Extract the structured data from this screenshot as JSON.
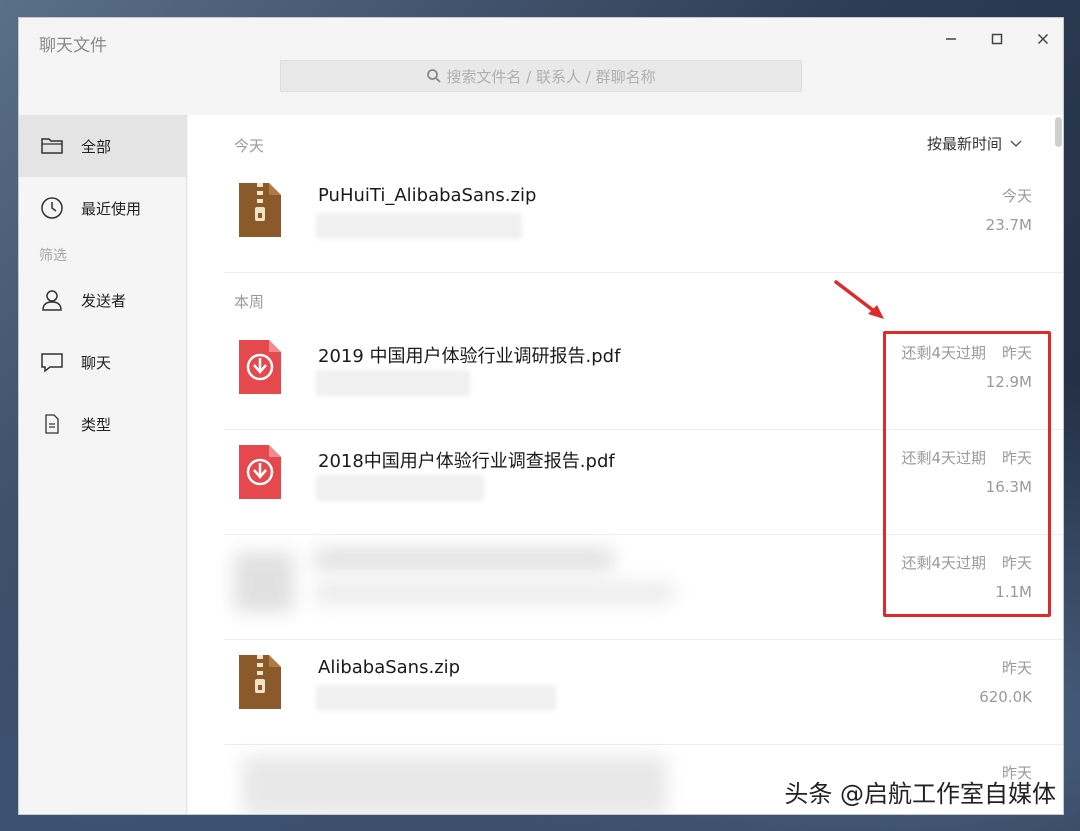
{
  "window": {
    "title": "聊天文件",
    "search_placeholder": "搜索文件名 / 联系人 / 群聊名称"
  },
  "sidebar": {
    "items": [
      {
        "label": "全部",
        "icon": "folder-icon",
        "active": true
      },
      {
        "label": "最近使用",
        "icon": "clock-icon"
      }
    ],
    "filter_label": "筛选",
    "filters": [
      {
        "label": "发送者",
        "icon": "person-icon"
      },
      {
        "label": "聊天",
        "icon": "chat-bubble-icon"
      },
      {
        "label": "类型",
        "icon": "document-icon"
      }
    ]
  },
  "main": {
    "sort_label": "按最新时间",
    "groups": [
      {
        "label": "今天"
      },
      {
        "label": "本周"
      }
    ],
    "files": [
      {
        "name": "PuHuiTi_AlibabaSans.zip",
        "type": "zip",
        "expiry": "",
        "time": "今天",
        "size": "23.7M"
      },
      {
        "name": "2019 中国用户体验行业调研报告.pdf",
        "type": "pdf",
        "expiry": "还剩4天过期",
        "time": "昨天",
        "size": "12.9M"
      },
      {
        "name": "2018中国用户体验行业调查报告.pdf",
        "type": "pdf",
        "expiry": "还剩4天过期",
        "time": "昨天",
        "size": "16.3M"
      },
      {
        "name": "",
        "type": "blurred",
        "expiry": "还剩4天过期",
        "time": "昨天",
        "size": "1.1M"
      },
      {
        "name": "AlibabaSans.zip",
        "type": "zip",
        "expiry": "",
        "time": "昨天",
        "size": "620.0K"
      },
      {
        "name": "",
        "type": "blurred",
        "expiry": "",
        "time": "昨天",
        "size": ""
      }
    ]
  },
  "colors": {
    "highlight": "#e02a2a",
    "zip_icon": "#8b5a2b",
    "pdf_icon": "#e5484d"
  },
  "watermark": "头条 @启航工作室自媒体"
}
